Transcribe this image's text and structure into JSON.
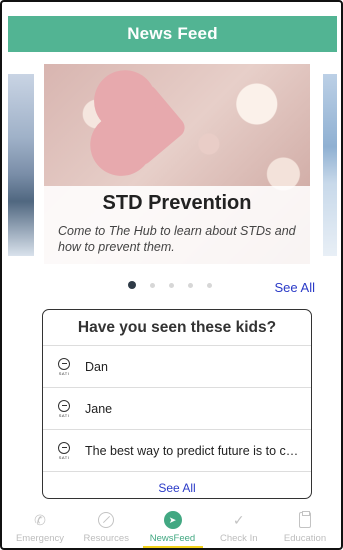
{
  "header": {
    "title": "News Feed"
  },
  "carousel": {
    "card": {
      "title": "STD Prevention",
      "description": "Come to The Hub to learn about STDs and how to prevent them."
    },
    "page_count": 5,
    "active_page": 1,
    "see_all_label": "See All"
  },
  "kids_panel": {
    "title": "Have you seen these kids?",
    "logo_text": "SATI",
    "items": [
      {
        "name": "Dan"
      },
      {
        "name": "Jane"
      },
      {
        "name": "The best way to predict future is to creat..."
      }
    ],
    "see_all_label": "See All"
  },
  "tabbar": {
    "tabs": [
      {
        "label": "Emergency",
        "icon": "phone-icon"
      },
      {
        "label": "Resources",
        "icon": "compass-icon"
      },
      {
        "label": "NewsFeed",
        "icon": "navigation-arrow-icon",
        "active": true
      },
      {
        "label": "Check In",
        "icon": "checkmark-icon"
      },
      {
        "label": "Education",
        "icon": "clipboard-icon"
      }
    ],
    "active_color": "#42a882",
    "indicator_color": "#f2d21a"
  },
  "colors": {
    "header_bg": "#52b493",
    "link": "#2a3ac7"
  }
}
